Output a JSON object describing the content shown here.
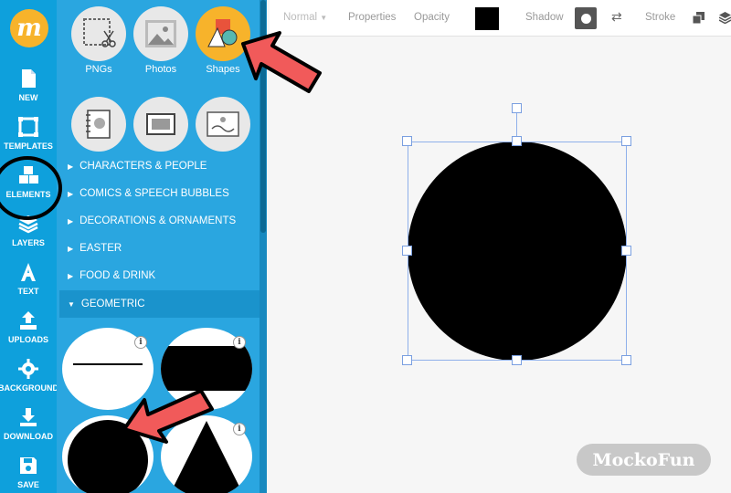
{
  "logo": {
    "letter": "m"
  },
  "rail": {
    "items": [
      {
        "label": "NEW",
        "icon": "new-file-icon"
      },
      {
        "label": "TEMPLATES",
        "icon": "templates-icon"
      },
      {
        "label": "ELEMENTS",
        "icon": "elements-icon"
      },
      {
        "label": "LAYERS",
        "icon": "layers-icon"
      },
      {
        "label": "TEXT",
        "icon": "text-icon"
      },
      {
        "label": "UPLOADS",
        "icon": "upload-icon"
      },
      {
        "label": "BACKGROUND",
        "icon": "gear-icon"
      },
      {
        "label": "DOWNLOAD",
        "icon": "download-icon"
      },
      {
        "label": "SAVE",
        "icon": "save-icon"
      }
    ]
  },
  "panel": {
    "categories": [
      {
        "label": "PNGs",
        "icon": "png-cutout-icon"
      },
      {
        "label": "Photos",
        "icon": "photo-icon"
      },
      {
        "label": "Shapes",
        "icon": "shapes-icon"
      }
    ],
    "tree": [
      {
        "label": "CHARACTERS & PEOPLE"
      },
      {
        "label": "COMICS & SPEECH BUBBLES"
      },
      {
        "label": "DECORATIONS & ORNAMENTS"
      },
      {
        "label": "EASTER"
      },
      {
        "label": "FOOD & DRINK"
      },
      {
        "label": "GEOMETRIC"
      }
    ],
    "info_glyph": "i"
  },
  "toolbar": {
    "blend": "Normal",
    "properties": "Properties",
    "opacity": "Opacity",
    "shadow": "Shadow",
    "stroke": "Stroke",
    "fill_color": "#000000"
  },
  "watermark": "MockoFun",
  "colors": {
    "rail": "#0ea0dc",
    "panel": "#2aa6e0",
    "accent": "#f7b32b",
    "arrow": "#f15a5a"
  }
}
